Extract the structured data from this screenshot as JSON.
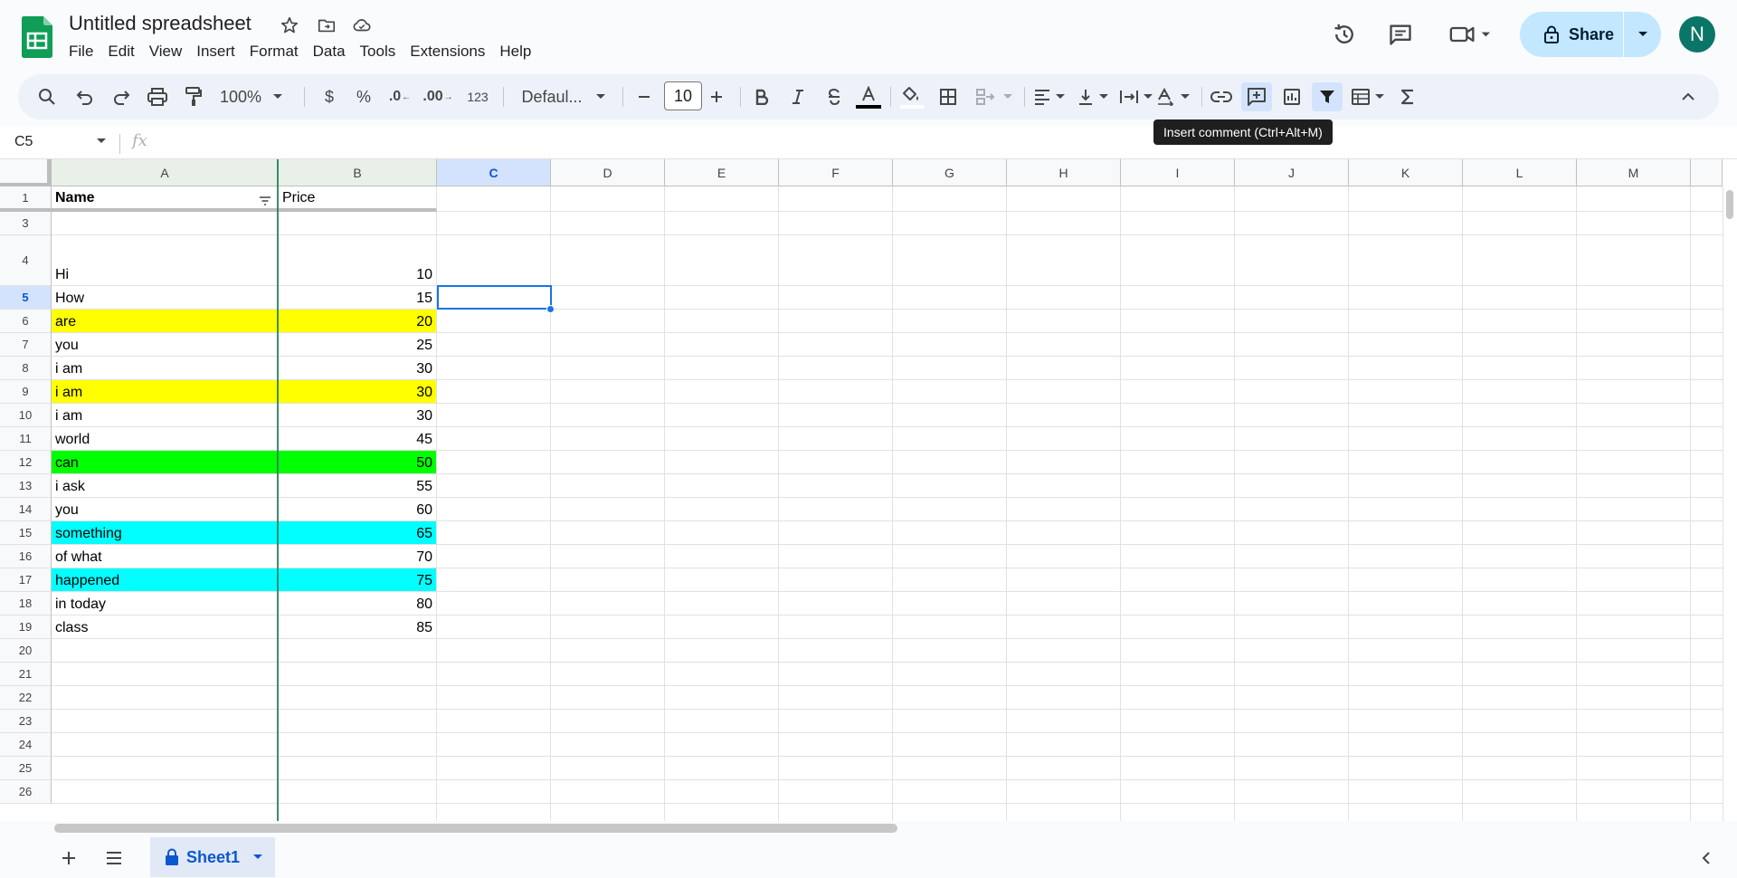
{
  "header": {
    "doc_title": "Untitled spreadsheet",
    "menu": [
      "File",
      "Edit",
      "View",
      "Insert",
      "Format",
      "Data",
      "Tools",
      "Extensions",
      "Help"
    ],
    "share_label": "Share",
    "avatar_letter": "N"
  },
  "toolbar": {
    "zoom": "100%",
    "currency": "$",
    "percent": "%",
    "dec_less": ".0",
    "dec_more": ".00",
    "format_123": "123",
    "font": "Defaul...",
    "font_size": "10",
    "tooltip": "Insert comment (Ctrl+Alt+M)"
  },
  "formula_bar": {
    "cell_ref": "C5",
    "fx": "fx"
  },
  "grid": {
    "columns": [
      "A",
      "B",
      "C",
      "D",
      "E",
      "F",
      "G",
      "H",
      "I",
      "J",
      "K",
      "L",
      "M"
    ],
    "selected_column": "C",
    "selected_row": "5",
    "row_numbers": [
      "1",
      "3",
      "4",
      "5",
      "6",
      "7",
      "8",
      "9",
      "10",
      "11",
      "12",
      "13",
      "14",
      "15",
      "16",
      "17",
      "18",
      "19",
      "20",
      "21",
      "22",
      "23",
      "24",
      "25",
      "26"
    ],
    "header_row": {
      "name": "Name",
      "price": "Price"
    },
    "rows": [
      {
        "row": "3",
        "name": "",
        "price": "",
        "fill": ""
      },
      {
        "row": "4",
        "name": "Hi",
        "price": "10",
        "fill": ""
      },
      {
        "row": "5",
        "name": "How",
        "price": "15",
        "fill": ""
      },
      {
        "row": "6",
        "name": "are",
        "price": "20",
        "fill": "#ffff00"
      },
      {
        "row": "7",
        "name": "you",
        "price": "25",
        "fill": ""
      },
      {
        "row": "8",
        "name": "i am",
        "price": "30",
        "fill": ""
      },
      {
        "row": "9",
        "name": "i am",
        "price": "30",
        "fill": "#ffff00"
      },
      {
        "row": "10",
        "name": "i am",
        "price": "30",
        "fill": ""
      },
      {
        "row": "11",
        "name": "world",
        "price": "45",
        "fill": ""
      },
      {
        "row": "12",
        "name": "can",
        "price": "50",
        "fill": "#00ff00"
      },
      {
        "row": "13",
        "name": "i ask",
        "price": "55",
        "fill": ""
      },
      {
        "row": "14",
        "name": "you",
        "price": "60",
        "fill": ""
      },
      {
        "row": "15",
        "name": "something",
        "price": "65",
        "fill": "#00ffff"
      },
      {
        "row": "16",
        "name": "of what",
        "price": "70",
        "fill": ""
      },
      {
        "row": "17",
        "name": "happened",
        "price": "75",
        "fill": "#00ffff"
      },
      {
        "row": "18",
        "name": "in today",
        "price": "80",
        "fill": ""
      },
      {
        "row": "19",
        "name": "class",
        "price": "85",
        "fill": ""
      }
    ]
  },
  "sheets": {
    "active": "Sheet1"
  },
  "colors": {
    "accent": "#0b57d0",
    "selection": "#1a73e8",
    "share_bg": "#c2e7ff",
    "avatar_bg": "#0b7568",
    "frozen_line": "#1e7a55"
  }
}
